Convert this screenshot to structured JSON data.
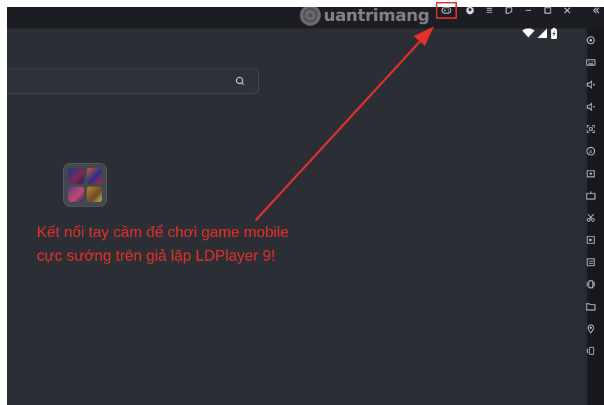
{
  "watermark": {
    "text": "uantrimang"
  },
  "search": {
    "placeholder": ""
  },
  "caption": {
    "line1": "Kết nối tay cầm để chơi game mobile",
    "line2": "cực sướng trên giả lập LDPlayer 9!"
  },
  "titlebar": {
    "buttons": [
      "gamepad-icon",
      "account-icon",
      "menu-icon",
      "screen-icon",
      "minimize-icon",
      "maximize-icon",
      "close-icon",
      "collapse-icon"
    ]
  },
  "sidebar": {
    "icons": [
      "settings-icon",
      "keyboard-icon",
      "volume-up-icon",
      "volume-down-icon",
      "fullscreen-icon",
      "operation-record-icon",
      "add-app-icon",
      "apk-icon",
      "screenshot-icon",
      "video-record-icon",
      "sync-icon",
      "shake-icon",
      "folder-icon",
      "location-icon",
      "rotate-icon"
    ]
  },
  "colors": {
    "accent": "#e0332b",
    "caption": "#e6302a",
    "background": "#2c2e35"
  }
}
